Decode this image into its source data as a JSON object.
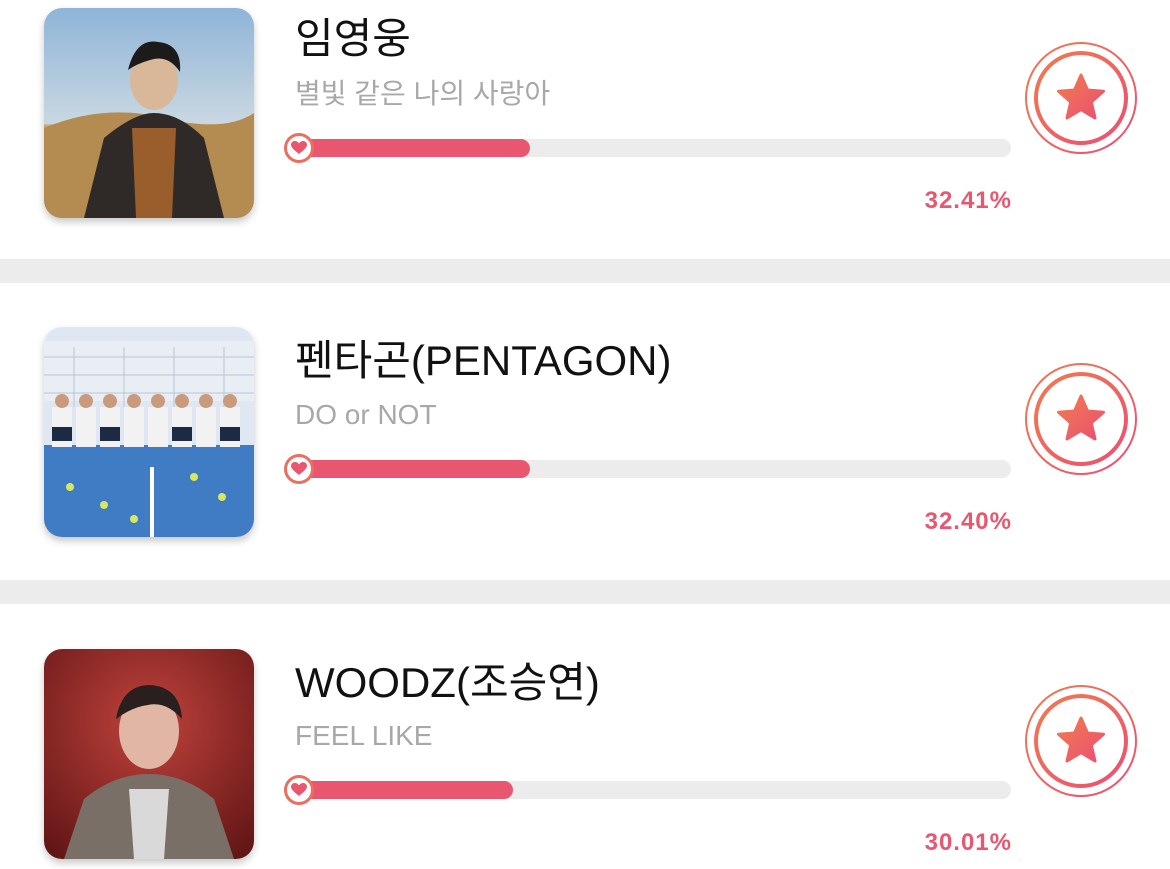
{
  "colors": {
    "accent": "#e8576f",
    "star_gradient_start": "#ef7c4f",
    "star_gradient_end": "#ec4f73",
    "track": "#ececec",
    "separator": "#ececec",
    "subtitle": "#a8a8a8"
  },
  "items": [
    {
      "name": "임영웅",
      "song": "별빛 같은 나의 사랑아",
      "percent_label": "32.41%",
      "progress": 0.3241,
      "thumbnail_icon": "artist-photo",
      "vote_icon": "star-icon"
    },
    {
      "name": "펜타곤(PENTAGON)",
      "song": "DO or NOT",
      "percent_label": "32.40%",
      "progress": 0.324,
      "thumbnail_icon": "group-photo",
      "vote_icon": "star-icon"
    },
    {
      "name": "WOODZ(조승연)",
      "song": "FEEL LIKE",
      "percent_label": "30.01%",
      "progress": 0.3001,
      "thumbnail_icon": "artist-photo",
      "vote_icon": "star-icon"
    }
  ]
}
